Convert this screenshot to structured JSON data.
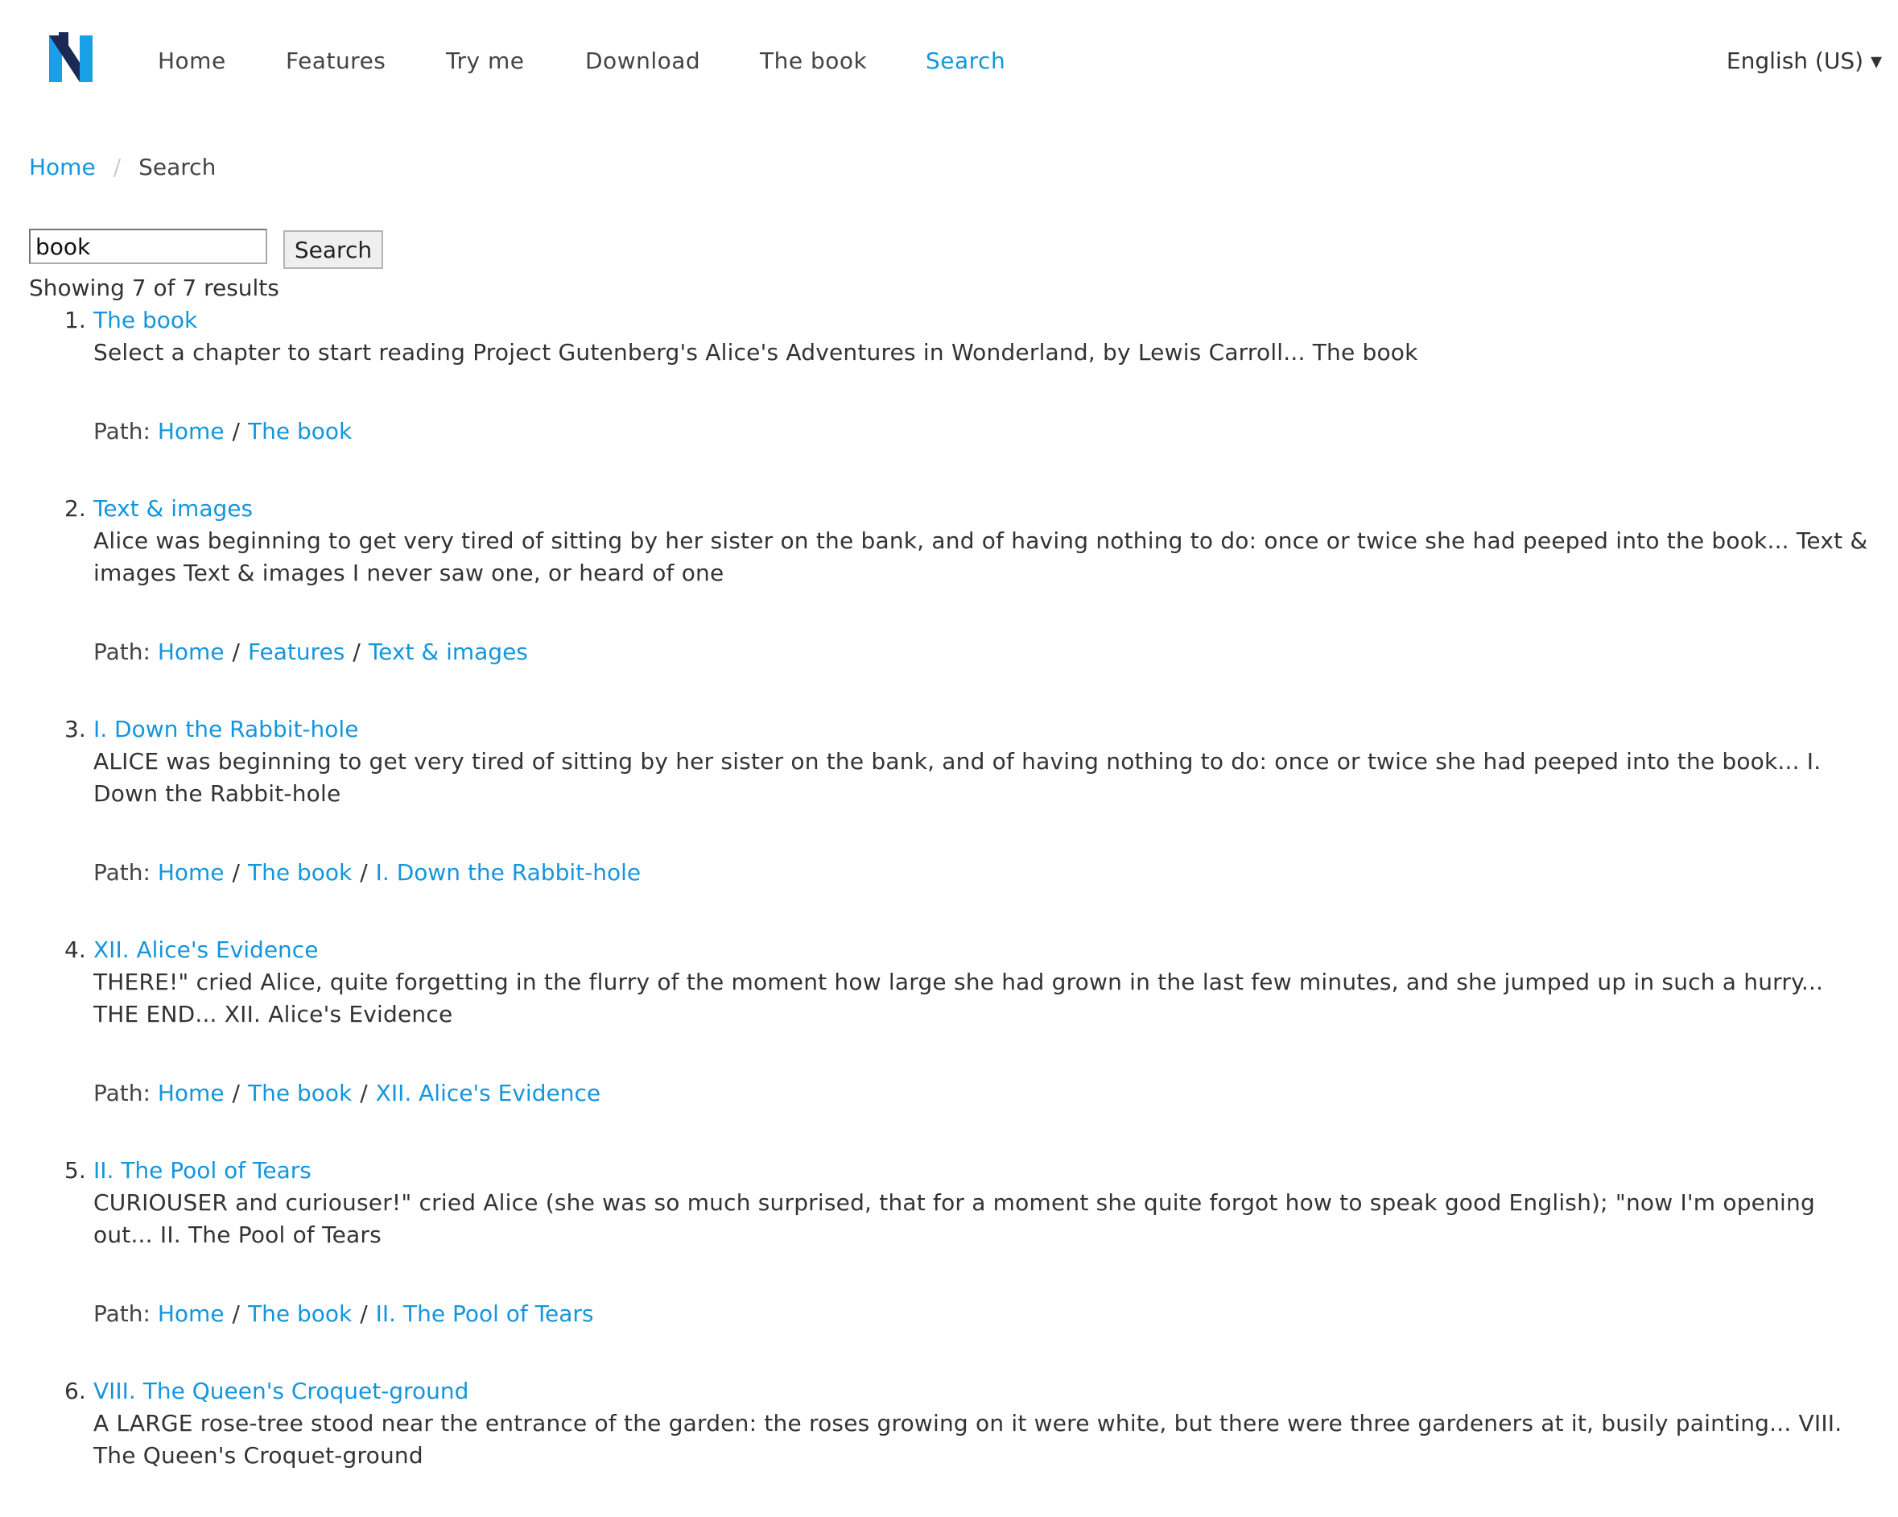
{
  "nav": {
    "logo_letter": "N",
    "items": [
      {
        "label": "Home",
        "active": false
      },
      {
        "label": "Features",
        "active": false
      },
      {
        "label": "Try me",
        "active": false
      },
      {
        "label": "Download",
        "active": false
      },
      {
        "label": "The book",
        "active": false
      },
      {
        "label": "Search",
        "active": true
      }
    ],
    "language": "English (US) ▾"
  },
  "breadcrumb": {
    "home": "Home",
    "separator": "/",
    "current": "Search"
  },
  "search": {
    "value": "book",
    "button_label": "Search"
  },
  "summary": "Showing 7 of 7 results",
  "path_label": "Path:",
  "results": [
    {
      "num": "1.",
      "title": "The book",
      "excerpt": "Select a chapter to start reading Project Gutenberg's Alice's Adventures in Wonderland, by Lewis Carroll... The book",
      "path": [
        "Home",
        "The book"
      ]
    },
    {
      "num": "2.",
      "title": "Text & images",
      "excerpt": "Alice was beginning to get very tired of sitting by her sister on the bank, and of having nothing to do: once or twice she had peeped into the book... Text & images Text & images I never saw one, or heard of one",
      "path": [
        "Home",
        "Features",
        "Text & images"
      ]
    },
    {
      "num": "3.",
      "title": "I. Down the Rabbit-hole",
      "excerpt": "ALICE was beginning to get very tired of sitting by her sister on the bank, and of having nothing to do: once or twice she had peeped into the book... I. Down the Rabbit-hole",
      "path": [
        "Home",
        "The book",
        "I. Down the Rabbit-hole"
      ]
    },
    {
      "num": "4.",
      "title": "XII. Alice's Evidence",
      "excerpt": "THERE!\" cried Alice, quite forgetting in the flurry of the moment how large she had grown in the last few minutes, and she jumped up in such a hurry... THE END... XII. Alice's Evidence",
      "path": [
        "Home",
        "The book",
        "XII. Alice's Evidence"
      ]
    },
    {
      "num": "5.",
      "title": "II. The Pool of Tears",
      "excerpt": "CURIOUSER and curiouser!\" cried Alice (she was so much surprised, that for a moment she quite forgot how to speak good English); \"now I'm opening out... II. The Pool of Tears",
      "path": [
        "Home",
        "The book",
        "II. The Pool of Tears"
      ]
    },
    {
      "num": "6.",
      "title": "VIII. The Queen's Croquet-ground",
      "excerpt": "A LARGE rose-tree stood near the entrance of the garden: the roses growing on it were white, but there were three gardeners at it, busily painting... VIII. The Queen's Croquet-ground",
      "path": []
    }
  ],
  "colors": {
    "link": "#1496dc",
    "text": "#333333",
    "logo_dark": "#1b2a55",
    "logo_blue": "#1aa0e6"
  }
}
